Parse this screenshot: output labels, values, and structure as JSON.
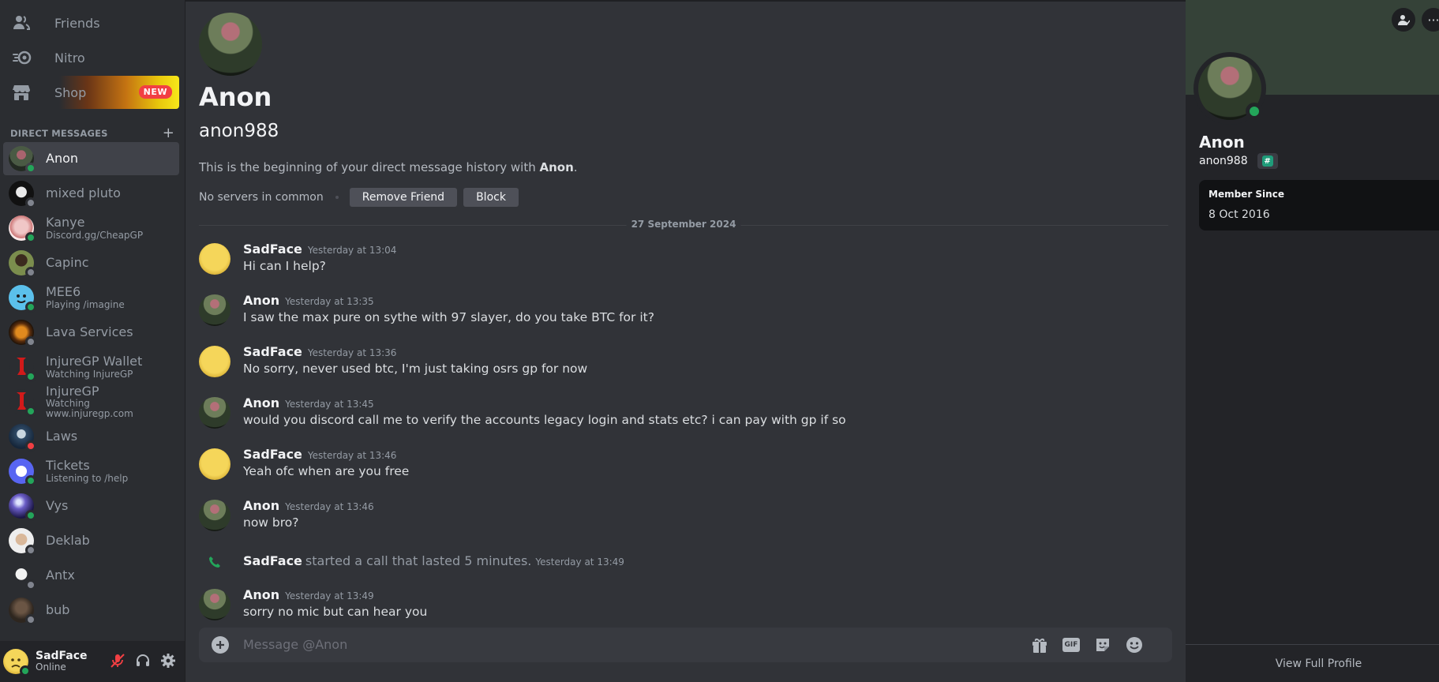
{
  "sidebar": {
    "nav": [
      {
        "label": "Friends",
        "icon": "friends-icon"
      },
      {
        "label": "Nitro",
        "icon": "nitro-icon"
      },
      {
        "label": "Shop",
        "icon": "shop-icon",
        "badge": "NEW"
      }
    ],
    "dm_header": "DIRECT MESSAGES",
    "dm_add": "+",
    "dms": [
      {
        "name": "Anon",
        "sub": "",
        "status": "online",
        "active": true
      },
      {
        "name": "mixed pluto",
        "sub": "",
        "status": "offline"
      },
      {
        "name": "Kanye",
        "sub": "Discord.gg/CheapGP",
        "status": "online"
      },
      {
        "name": "Capinc",
        "sub": "",
        "status": "offline"
      },
      {
        "name": "MEE6",
        "sub": "Playing /imagine",
        "status": "online"
      },
      {
        "name": "Lava Services",
        "sub": "",
        "status": "offline"
      },
      {
        "name": "InjureGP Wallet",
        "sub": "Watching InjureGP",
        "status": "online"
      },
      {
        "name": "InjureGP",
        "sub": "Watching www.injuregp.com",
        "status": "online"
      },
      {
        "name": "Laws",
        "sub": "",
        "status": "dnd"
      },
      {
        "name": "Tickets",
        "sub": "Listening to /help",
        "status": "online"
      },
      {
        "name": "Vys",
        "sub": "",
        "status": "online"
      },
      {
        "name": "Deklab",
        "sub": "",
        "status": "offline"
      },
      {
        "name": "Antx",
        "sub": "",
        "status": "offline"
      },
      {
        "name": "bub",
        "sub": "",
        "status": "offline"
      }
    ],
    "user": {
      "name": "SadFace",
      "status": "Online"
    }
  },
  "chat": {
    "profile_name": "Anon",
    "profile_username": "anon988",
    "intro_prefix": "This is the beginning of your direct message history with ",
    "intro_name": "Anon",
    "intro_suffix": ".",
    "no_servers": "No servers in common",
    "remove_friend": "Remove Friend",
    "block": "Block",
    "date_divider": "27 September 2024",
    "messages": [
      {
        "author": "SadFace",
        "time": "Yesterday at 13:04",
        "text": "Hi can I help?"
      },
      {
        "author": "Anon",
        "time": "Yesterday at 13:35",
        "text": "I saw the max pure on sythe with 97 slayer, do you take BTC for it?"
      },
      {
        "author": "SadFace",
        "time": "Yesterday at 13:36",
        "text": "No sorry, never used btc, I'm just taking osrs gp for now"
      },
      {
        "author": "Anon",
        "time": "Yesterday at 13:45",
        "text": "would you discord call me to verify the accounts legacy login and stats etc? i can pay with gp if so"
      },
      {
        "author": "SadFace",
        "time": "Yesterday at 13:46",
        "text": "Yeah ofc when are you free"
      },
      {
        "author": "Anon",
        "time": "Yesterday at 13:46",
        "text": "now bro?"
      }
    ],
    "call": {
      "author": "SadFace",
      "text": "started a call that lasted 5 minutes.",
      "time": "Yesterday at 13:49"
    },
    "last_message": {
      "author": "Anon",
      "time": "Yesterday at 13:49",
      "text": "sorry no mic but can hear you"
    },
    "composer_placeholder": "Message @Anon",
    "gif_label": "GIF"
  },
  "profile_panel": {
    "name": "Anon",
    "username": "anon988",
    "tag_symbol": "#",
    "more_glyph": "···",
    "member_since_label": "Member Since",
    "member_since_date": "8 Oct 2016",
    "view_full_profile": "View Full Profile"
  },
  "colors": {
    "background": "#313338",
    "sidebar": "#2b2d31",
    "online": "#23a55a",
    "dnd": "#f23f43",
    "offline": "#80848e",
    "new_badge": "#f23f43"
  }
}
